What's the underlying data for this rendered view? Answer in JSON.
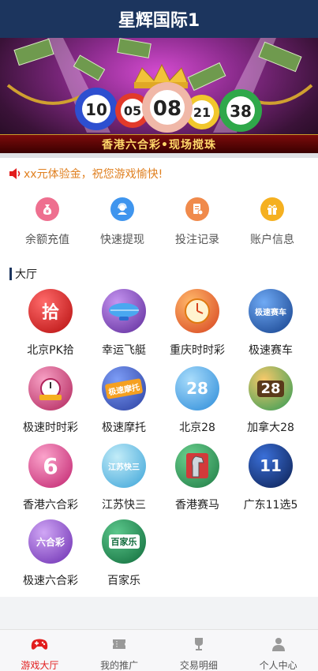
{
  "header": {
    "title": "星辉国际1"
  },
  "banner": {
    "balls": [
      "10",
      "05",
      "08",
      "21",
      "38"
    ],
    "caption": "香港六合彩•现场搅珠"
  },
  "notice": {
    "text": "xx元体验金，祝您游戏愉快!"
  },
  "quick_actions": [
    {
      "label": "余额充值",
      "icon": "money-bag-icon",
      "color": "#ee6f8f"
    },
    {
      "label": "快速提现",
      "icon": "support-agent-icon",
      "color": "#3f95ee"
    },
    {
      "label": "投注记录",
      "icon": "record-document-icon",
      "color": "#f08a4b"
    },
    {
      "label": "账户信息",
      "icon": "gift-icon",
      "color": "#f5b020"
    }
  ],
  "section": {
    "title": "大厅"
  },
  "games": [
    {
      "label": "北京PK拾",
      "icon_text": "拾",
      "colors": [
        "#ff4b4b",
        "#b50d0d"
      ]
    },
    {
      "label": "幸运飞艇",
      "icon_text": "",
      "colors": [
        "#a86be0",
        "#5d2a9a"
      ]
    },
    {
      "label": "重庆时时彩",
      "icon_text": "",
      "colors": [
        "#ff9a3c",
        "#d6421e"
      ]
    },
    {
      "label": "极速赛车",
      "icon_text": "极速赛车",
      "colors": [
        "#4b8ff0",
        "#143f8a"
      ]
    },
    {
      "label": "极速时时彩",
      "icon_text": "",
      "colors": [
        "#f07aa8",
        "#b0235a"
      ]
    },
    {
      "label": "极速摩托",
      "icon_text": "极速摩托",
      "colors": [
        "#5a7ff2",
        "#2a3fa0"
      ]
    },
    {
      "label": "北京28",
      "icon_text": "28",
      "colors": [
        "#7cc6f5",
        "#2a8ad8"
      ]
    },
    {
      "label": "加拿大28",
      "icon_text": "28",
      "colors": [
        "#f7b64a",
        "#2d9a55"
      ]
    },
    {
      "label": "香港六合彩",
      "icon_text": "6",
      "colors": [
        "#f77ab2",
        "#c0216d"
      ]
    },
    {
      "label": "江苏快三",
      "icon_text": "江苏快三",
      "colors": [
        "#8ad8f0",
        "#3aa3d8"
      ]
    },
    {
      "label": "香港赛马",
      "icon_text": "",
      "colors": [
        "#3fb06a",
        "#d23a3a"
      ]
    },
    {
      "label": "广东11选5",
      "icon_text": "11",
      "colors": [
        "#3a6fd8",
        "#0c1f50"
      ]
    },
    {
      "label": "极速六合彩",
      "icon_text": "六合彩",
      "colors": [
        "#b07ae6",
        "#6a2cb0"
      ]
    },
    {
      "label": "百家乐",
      "icon_text": "百家乐",
      "colors": [
        "#32a868",
        "#0f6a3a"
      ]
    }
  ],
  "tabs": [
    {
      "label": "游戏大厅",
      "icon": "gamepad-icon",
      "active": true
    },
    {
      "label": "我的推广",
      "icon": "ticket-icon",
      "active": false
    },
    {
      "label": "交易明细",
      "icon": "trophy-icon",
      "active": false
    },
    {
      "label": "个人中心",
      "icon": "user-icon",
      "active": false
    }
  ],
  "colors": {
    "header_bg": "#1c355e",
    "active_tab": "#e21d1d",
    "notice": "#e08020"
  }
}
